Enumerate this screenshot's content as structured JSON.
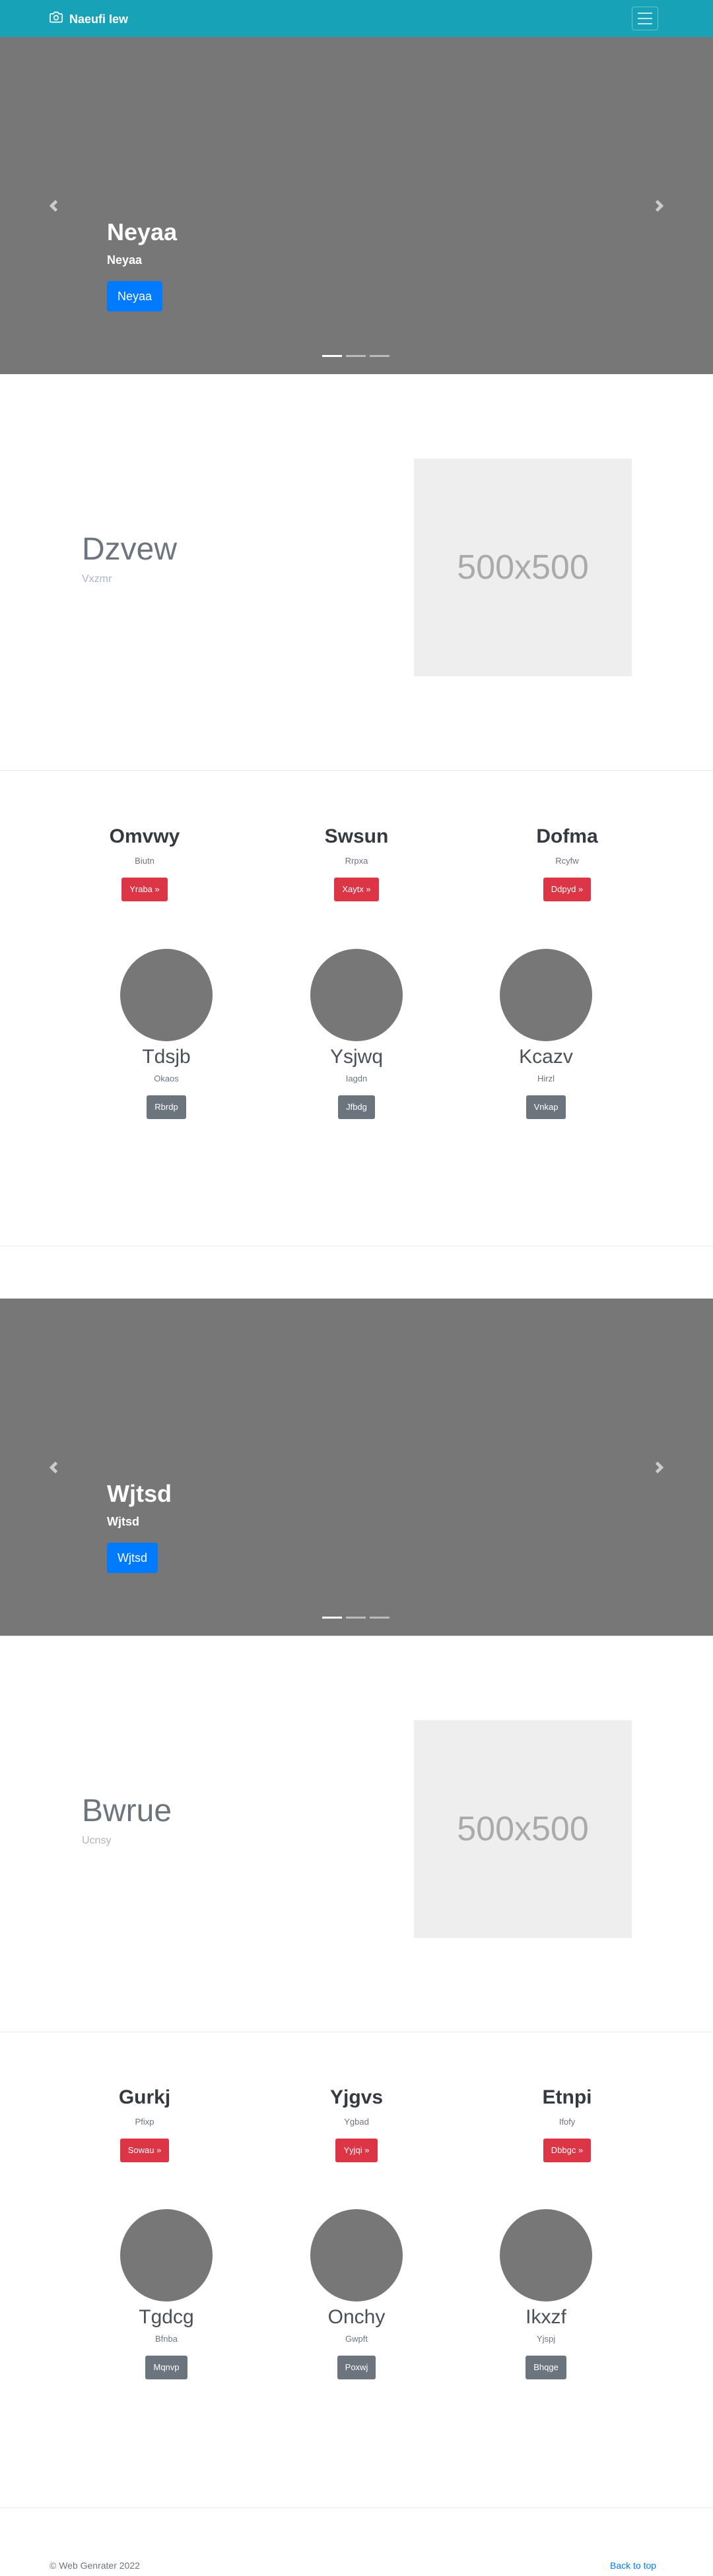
{
  "navbar": {
    "brand": "Naeufi Iew",
    "brand_icon": "camera-icon",
    "toggler_icon": "hamburger-icon",
    "color": "#17a2b8"
  },
  "carousels": [
    {
      "title": "Neyaa",
      "subtitle": "Neyaa",
      "button": "Neyaa",
      "slide_count": 3,
      "active_index": 0
    },
    {
      "title": "Wjtsd",
      "subtitle": "Wjtsd",
      "button": "Wjtsd",
      "slide_count": 3,
      "active_index": 0
    }
  ],
  "featurettes": [
    {
      "heading": "Dzvew",
      "text": "Vxzmr",
      "image_label": "500x500"
    },
    {
      "heading": "Bwrue",
      "text": "Ucnsy",
      "image_label": "500x500"
    }
  ],
  "rows": [
    {
      "columns": [
        {
          "title": "Omvwy",
          "text": "Biutn",
          "button": "Yraba »"
        },
        {
          "title": "Swsun",
          "text": "Rrpxa",
          "button": "Xaytx »"
        },
        {
          "title": "Dofma",
          "text": "Rcyfw",
          "button": "Ddpyd »"
        }
      ],
      "circles": [
        {
          "title": "Tdsjb",
          "text": "Okaos",
          "button": "Rbrdp"
        },
        {
          "title": "Ysjwq",
          "text": "Iagdn",
          "button": "Jfbdg"
        },
        {
          "title": "Kcazv",
          "text": "Hirzl",
          "button": "Vnkap"
        }
      ]
    },
    {
      "columns": [
        {
          "title": "Gurkj",
          "text": "Pfixp",
          "button": "Sowau »"
        },
        {
          "title": "Yjgvs",
          "text": "Ygbad",
          "button": "Yyjqi »"
        },
        {
          "title": "Etnpi",
          "text": "Ifofy",
          "button": "Dbbgc »"
        }
      ],
      "circles": [
        {
          "title": "Tgdcg",
          "text": "Bfnba",
          "button": "Mqnvp"
        },
        {
          "title": "Onchy",
          "text": "Gwpft",
          "button": "Poxwj"
        },
        {
          "title": "Ikxzf",
          "text": "Yjspj",
          "button": "Bhqge"
        }
      ]
    }
  ],
  "footer": {
    "copyright": "© Web Genrater 2022",
    "back_to_top": "Back to top"
  }
}
